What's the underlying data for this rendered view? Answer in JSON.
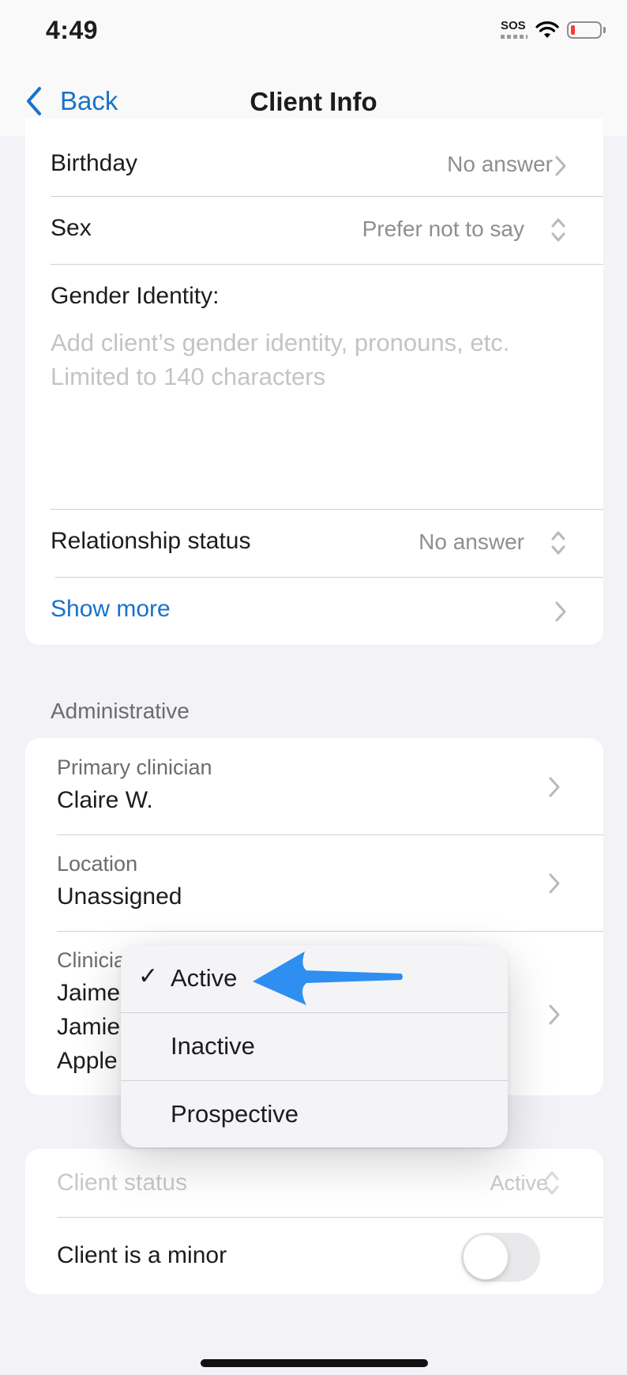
{
  "status_bar": {
    "time": "4:49",
    "sos": "SOS",
    "battery_color": "#ff3b30"
  },
  "nav": {
    "back_label": "Back",
    "title": "Client Info"
  },
  "personal": {
    "birthday": {
      "label": "Birthday",
      "value": "No answer"
    },
    "sex": {
      "label": "Sex",
      "value": "Prefer not to say"
    },
    "gender_identity": {
      "label": "Gender Identity:",
      "placeholder_line1": "Add client’s gender identity, pronouns, etc.",
      "placeholder_line2": "Limited to 140 characters"
    },
    "relationship_status": {
      "label": "Relationship status",
      "value": "No answer"
    },
    "show_more": "Show more"
  },
  "administrative": {
    "header": "Administrative",
    "primary_clinician": {
      "label": "Primary clinician",
      "value": "Claire W."
    },
    "location": {
      "label": "Location",
      "value": "Unassigned"
    },
    "clinicians": {
      "label": "Clinicia",
      "line1": "Jaime",
      "line2": "Jamie",
      "line3": "Apple"
    }
  },
  "status_menu": {
    "options": [
      {
        "label": "Active",
        "selected": true,
        "check": "✓"
      },
      {
        "label": "Inactive",
        "selected": false
      },
      {
        "label": "Prospective",
        "selected": false
      }
    ]
  },
  "client_settings": {
    "client_status": {
      "label": "Client status",
      "value": "Active"
    },
    "minor": {
      "label": "Client is a minor",
      "on": false
    }
  },
  "colors": {
    "accent": "#1a72c9",
    "annotation_arrow": "#2f8ff0",
    "background": "#f2f2f7"
  }
}
